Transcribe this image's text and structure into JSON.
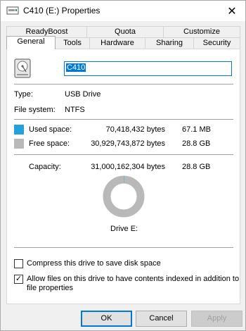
{
  "window": {
    "title": "C410 (E:) Properties",
    "close_glyph": "✕"
  },
  "tabs": {
    "row1": [
      "ReadyBoost",
      "Quota",
      "Customize"
    ],
    "row2": [
      "General",
      "Tools",
      "Hardware",
      "Sharing",
      "Security"
    ],
    "active": "General"
  },
  "general": {
    "drive_name": "C410",
    "type_label": "Type:",
    "type_value": "USB Drive",
    "fs_label": "File system:",
    "fs_value": "NTFS",
    "used_label": "Used space:",
    "used_bytes": "70,418,432 bytes",
    "used_size": "67.1 MB",
    "free_label": "Free space:",
    "free_bytes": "30,929,743,872 bytes",
    "free_size": "28.8 GB",
    "capacity_label": "Capacity:",
    "capacity_bytes": "31,000,162,304 bytes",
    "capacity_size": "28.8 GB",
    "drive_label": "Drive E:",
    "used_fraction": 0.00227,
    "used_color": "#26a0da",
    "free_color": "#b9b9b9"
  },
  "options": {
    "compress_label": "Compress this drive to save disk space",
    "compress_checked": false,
    "index_label_line1": "Allow files on this drive to have contents indexed in addition to",
    "index_label_line2": "file properties",
    "index_checked": true,
    "check_glyph": "✓"
  },
  "buttons": {
    "ok": "OK",
    "cancel": "Cancel",
    "apply": "Apply"
  }
}
